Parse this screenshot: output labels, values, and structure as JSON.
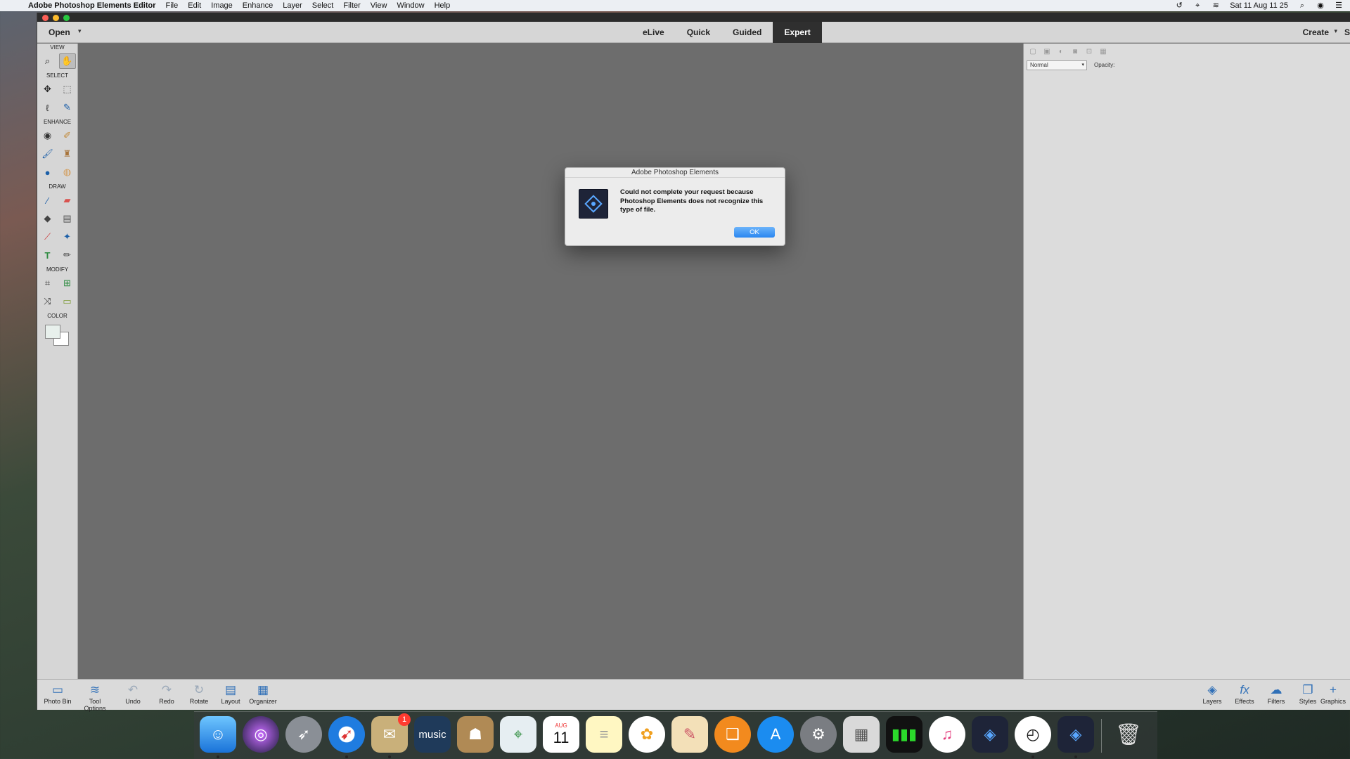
{
  "menubar": {
    "app_name": "Adobe Photoshop Elements Editor",
    "items": [
      "File",
      "Edit",
      "Image",
      "Enhance",
      "Layer",
      "Select",
      "Filter",
      "View",
      "Window",
      "Help"
    ],
    "clock": "Sat 11 Aug  11 25"
  },
  "topbar": {
    "open_label": "Open",
    "modes": [
      "eLive",
      "Quick",
      "Guided",
      "Expert"
    ],
    "active_mode": "Expert",
    "create_label": "Create",
    "share_label": "S"
  },
  "toolbox": {
    "sections": {
      "view": "VIEW",
      "select": "SELECT",
      "enhance": "ENHANCE",
      "draw": "DRAW",
      "modify": "MODIFY",
      "color": "COLOR"
    }
  },
  "right_panel": {
    "blend_mode": "Normal",
    "opacity_label": "Opacity:"
  },
  "bottom_left": [
    {
      "label": "Photo Bin",
      "icon": "photo-bin-icon"
    },
    {
      "label": "Tool Options",
      "icon": "tool-options-icon"
    },
    {
      "label": "Undo",
      "icon": "undo-icon"
    },
    {
      "label": "Redo",
      "icon": "redo-icon"
    },
    {
      "label": "Rotate",
      "icon": "rotate-icon"
    },
    {
      "label": "Layout",
      "icon": "layout-icon"
    },
    {
      "label": "Organizer",
      "icon": "organizer-icon"
    }
  ],
  "bottom_right": [
    {
      "label": "Layers",
      "icon": "layers-icon"
    },
    {
      "label": "Effects",
      "icon": "effects-icon"
    },
    {
      "label": "Filters",
      "icon": "filters-icon"
    },
    {
      "label": "Styles",
      "icon": "styles-icon"
    },
    {
      "label": "Graphics",
      "icon": "graphics-icon"
    }
  ],
  "dialog": {
    "title": "Adobe Photoshop Elements",
    "message": "Could not complete your request because Photoshop Elements does not recognize this type of file.",
    "ok_label": "OK"
  },
  "dock": {
    "music_label": "music",
    "calendar_month": "AUG",
    "calendar_day": "11",
    "mail_badge": "1"
  },
  "colors": {
    "accent": "#2a86f0",
    "canvas": "#6d6d6d",
    "active_mode_bg": "#2f2f2f"
  }
}
